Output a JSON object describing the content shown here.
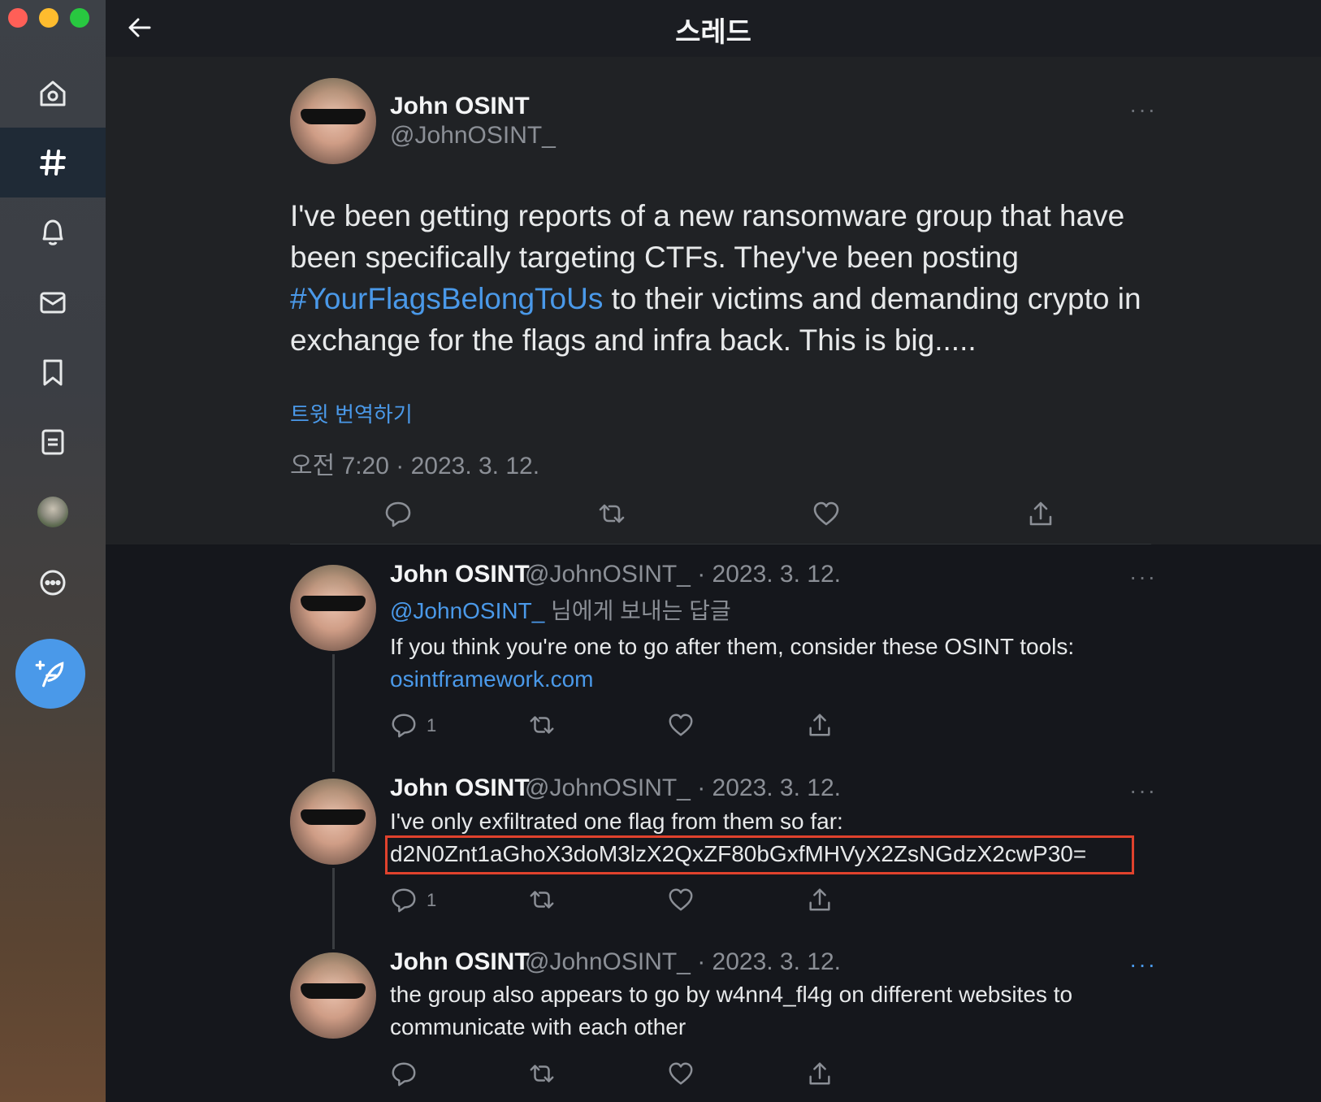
{
  "page": {
    "title": "스레드"
  },
  "sidebar": {
    "items": [
      "home-icon",
      "explore-icon",
      "notifications-icon",
      "messages-icon",
      "bookmarks-icon",
      "lists-icon",
      "profile-icon",
      "more-icon"
    ],
    "active": "explore-icon"
  },
  "main_tweet": {
    "name": "John OSINT",
    "handle": "@JohnOSINT_",
    "text_before": "I've been getting reports of a new ransomware group that have been specifically targeting CTFs. They've been posting ",
    "hashtag": "#YourFlagsBelongToUs",
    "text_after": " to their victims and demanding crypto in exchange for the flags and infra back. This is big.....",
    "translate_label": "트윗 번역하기",
    "timestamp": "오전 7:20 · 2023. 3. 12."
  },
  "replies": [
    {
      "name": "John OSINT",
      "handle_date": "@JohnOSINT_ · 2023. 3. 12.",
      "reply_to_handle": "@JohnOSINT_",
      "reply_to_suffix": " 님에게 보내는 답글",
      "line1": "If you think you're one to go after them, consider these OSINT tools:",
      "link": "osintframework.com",
      "reply_count": "1"
    },
    {
      "name": "John OSINT",
      "handle_date": "@JohnOSINT_ · 2023. 3. 12.",
      "line1": "I've only exfiltrated one flag from them so far:",
      "flag": "d2N0Znt1aGhoX3doM3lzX2QxZF80bGxfMHVyX2ZsNGdzX2cwP30=",
      "reply_count": "1"
    },
    {
      "name": "John OSINT",
      "handle_date": "@JohnOSINT_ · 2023. 3. 12.",
      "line1": "the group also appears to go by w4nn4_fl4g on different websites to",
      "line2": "communicate with each other"
    }
  ],
  "colors": {
    "accent": "#4a99e9",
    "highlight_box": "#e0422d",
    "background": "#15171c"
  }
}
